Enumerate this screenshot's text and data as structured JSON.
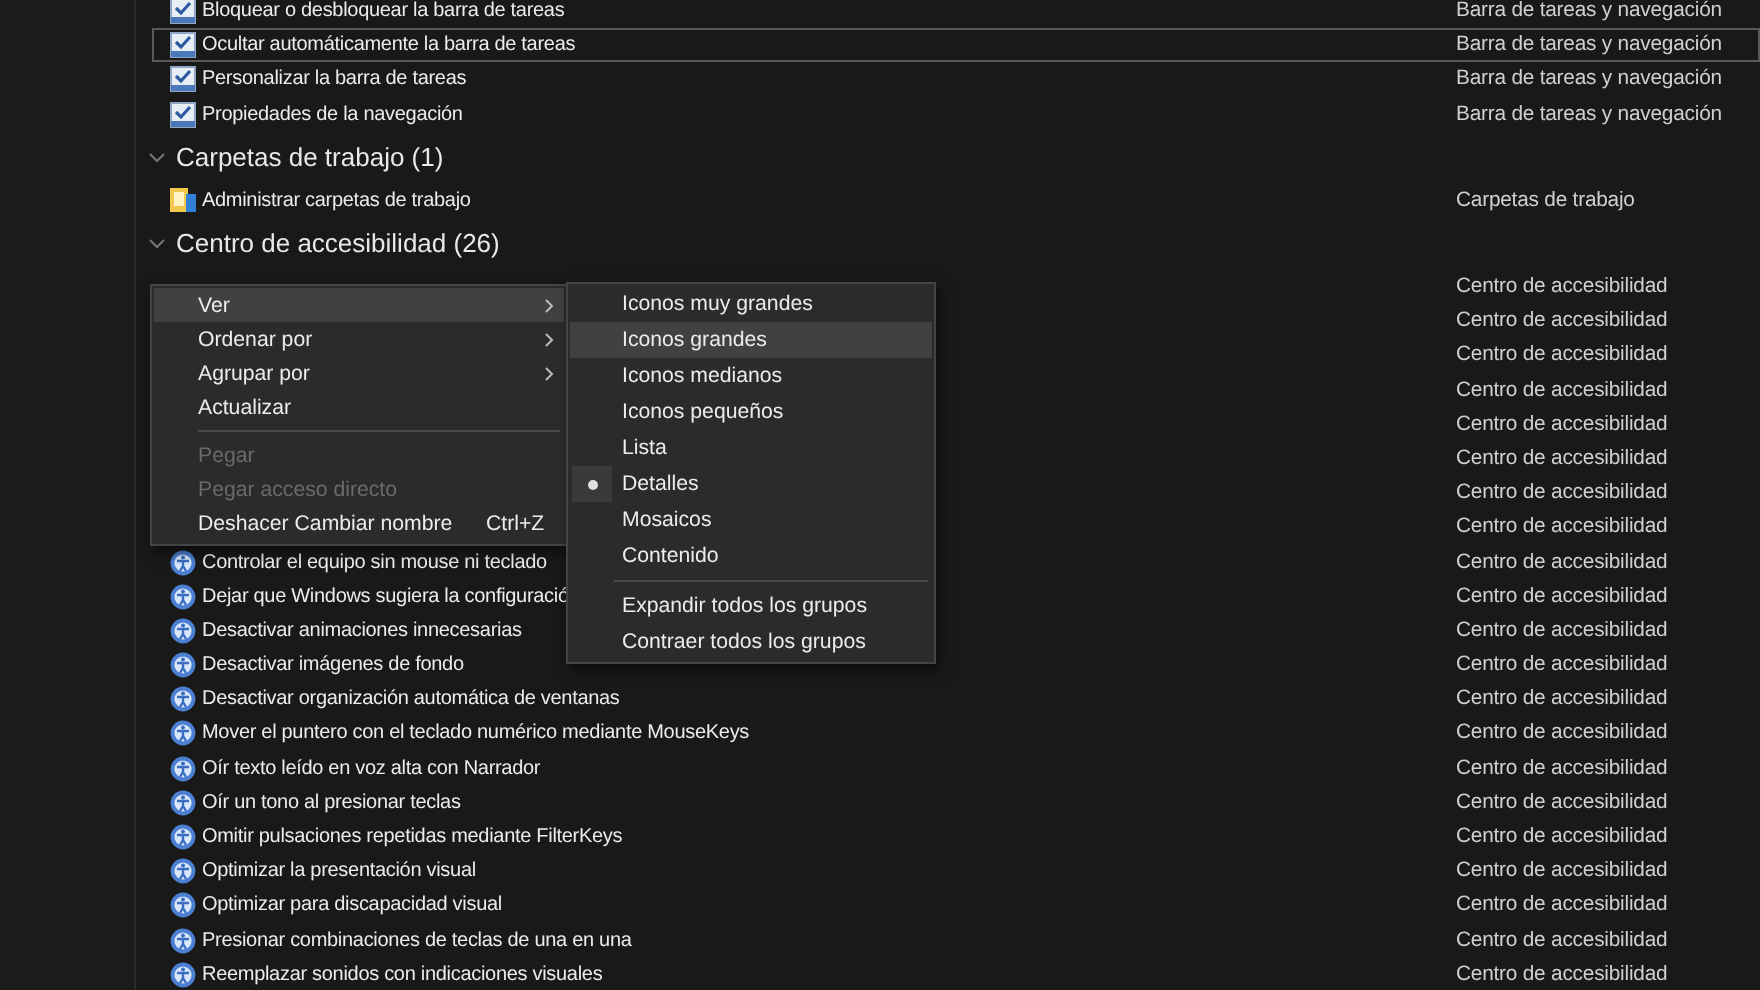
{
  "groups": [
    {
      "kind": "taskbar",
      "rows": [
        {
          "name": "Bloquear o desbloquear la barra de tareas",
          "category": "Barra de tareas y navegación",
          "focused": false
        },
        {
          "name": "Ocultar automáticamente la barra de tareas",
          "category": "Barra de tareas y navegación",
          "focused": true
        },
        {
          "name": "Personalizar la barra de tareas",
          "category": "Barra de tareas y navegación",
          "focused": false
        },
        {
          "name": "Propiedades de la navegación",
          "category": "Barra de tareas y navegación",
          "focused": false
        }
      ]
    },
    {
      "title": "Carpetas de trabajo (1)",
      "kind": "folders",
      "rows": [
        {
          "name": "Administrar carpetas de trabajo",
          "category": "Carpetas de trabajo",
          "focused": false
        }
      ]
    },
    {
      "title": "Centro de accesibilidad (26)",
      "kind": "accessibility",
      "rows": [
        {
          "category": "Centro de accesibilidad",
          "focused": false
        },
        {
          "category": "Centro de accesibilidad",
          "focused": false
        },
        {
          "category": "Centro de accesibilidad",
          "focused": false
        },
        {
          "category": "Centro de accesibilidad",
          "focused": false
        },
        {
          "category": "Centro de accesibilidad",
          "focused": false
        },
        {
          "category": "Centro de accesibilidad",
          "focused": false
        },
        {
          "category": "Centro de accesibilidad",
          "focused": false
        },
        {
          "category": "Centro de accesibilidad",
          "focused": false
        },
        {
          "name": "Controlar el equipo sin mouse ni teclado",
          "category": "Centro de accesibilidad",
          "focused": false
        },
        {
          "name": "Dejar que Windows sugiera la configuració",
          "category": "Centro de accesibilidad",
          "focused": false
        },
        {
          "name": "Desactivar animaciones innecesarias",
          "category": "Centro de accesibilidad",
          "focused": false
        },
        {
          "name": "Desactivar imágenes de fondo",
          "category": "Centro de accesibilidad",
          "focused": false
        },
        {
          "name": "Desactivar organización automática de ventanas",
          "category": "Centro de accesibilidad",
          "focused": false
        },
        {
          "name": "Mover el puntero con el teclado numérico mediante MouseKeys",
          "category": "Centro de accesibilidad",
          "focused": false
        },
        {
          "name": "Oír texto leído en voz alta con Narrador",
          "category": "Centro de accesibilidad",
          "focused": false
        },
        {
          "name": "Oír un tono al presionar teclas",
          "category": "Centro de accesibilidad",
          "focused": false
        },
        {
          "name": "Omitir pulsaciones repetidas mediante FilterKeys",
          "category": "Centro de accesibilidad",
          "focused": false
        },
        {
          "name": "Optimizar la presentación visual",
          "category": "Centro de accesibilidad",
          "focused": false
        },
        {
          "name": "Optimizar para discapacidad visual",
          "category": "Centro de accesibilidad",
          "focused": false
        },
        {
          "name": "Presionar combinaciones de teclas de una en una",
          "category": "Centro de accesibilidad",
          "focused": false
        },
        {
          "name": "Reemplazar sonidos con indicaciones visuales",
          "category": "Centro de accesibilidad",
          "focused": false
        }
      ]
    }
  ],
  "context_menu": [
    {
      "kind": "item",
      "label": "Ver",
      "submenu": true,
      "highlighted": true,
      "disabled": false
    },
    {
      "kind": "item",
      "label": "Ordenar por",
      "submenu": true,
      "highlighted": false,
      "disabled": false
    },
    {
      "kind": "item",
      "label": "Agrupar por",
      "submenu": true,
      "highlighted": false,
      "disabled": false
    },
    {
      "kind": "item",
      "label": "Actualizar",
      "submenu": false,
      "highlighted": false,
      "disabled": false
    },
    {
      "kind": "separator"
    },
    {
      "kind": "item",
      "label": "Pegar",
      "submenu": false,
      "highlighted": false,
      "disabled": true
    },
    {
      "kind": "item",
      "label": "Pegar acceso directo",
      "submenu": false,
      "highlighted": false,
      "disabled": true
    },
    {
      "kind": "item",
      "label": "Deshacer Cambiar nombre",
      "shortcut": "Ctrl+Z",
      "submenu": false,
      "highlighted": false,
      "disabled": false
    }
  ],
  "view_submenu": [
    {
      "kind": "item",
      "label": "Iconos muy grandes",
      "highlighted": false,
      "selected": false
    },
    {
      "kind": "item",
      "label": "Iconos grandes",
      "highlighted": true,
      "selected": false
    },
    {
      "kind": "item",
      "label": "Iconos medianos",
      "highlighted": false,
      "selected": false
    },
    {
      "kind": "item",
      "label": "Iconos pequeños",
      "highlighted": false,
      "selected": false
    },
    {
      "kind": "item",
      "label": "Lista",
      "highlighted": false,
      "selected": false
    },
    {
      "kind": "item",
      "label": "Detalles",
      "highlighted": false,
      "selected": true
    },
    {
      "kind": "item",
      "label": "Mosaicos",
      "highlighted": false,
      "selected": false
    },
    {
      "kind": "item",
      "label": "Contenido",
      "highlighted": false,
      "selected": false
    },
    {
      "kind": "separator"
    },
    {
      "kind": "item",
      "label": "Expandir todos los grupos",
      "highlighted": false,
      "selected": false
    },
    {
      "kind": "item",
      "label": "Contraer todos los grupos",
      "highlighted": false,
      "selected": false
    }
  ]
}
